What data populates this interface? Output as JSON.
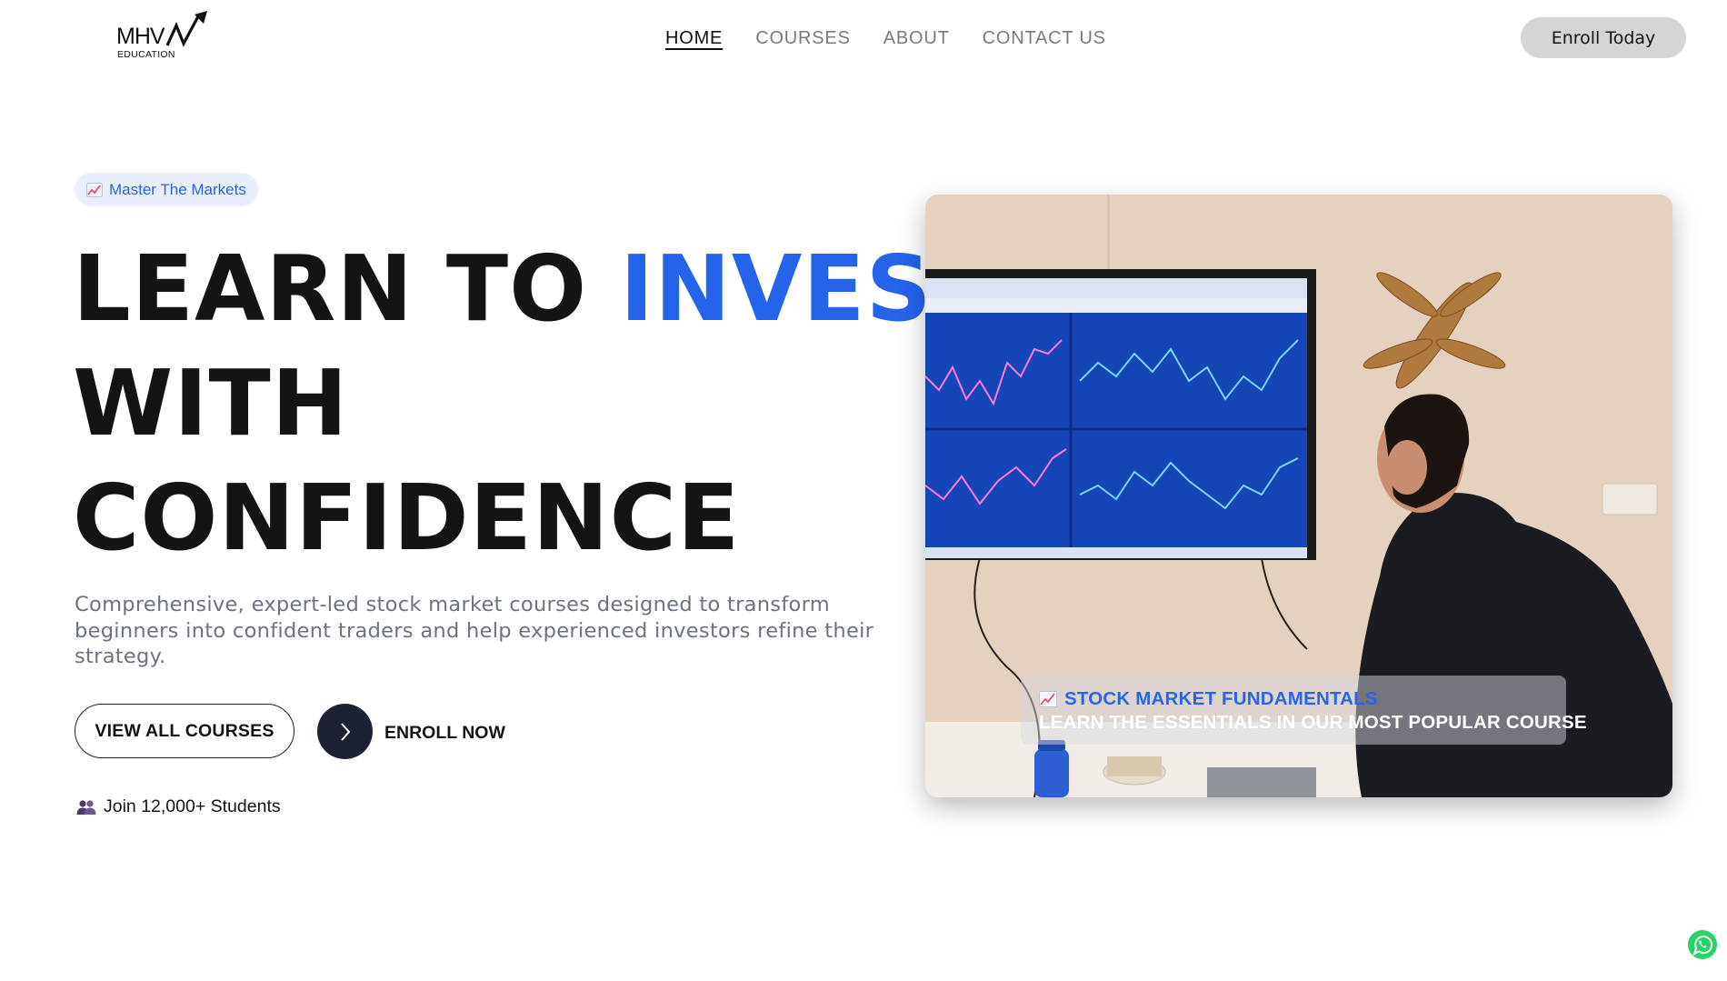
{
  "header": {
    "logo_text": "MHV",
    "logo_sub": "EDUCATION",
    "nav": [
      {
        "label": "HOME",
        "active": true
      },
      {
        "label": "COURSES",
        "active": false
      },
      {
        "label": "ABOUT",
        "active": false
      },
      {
        "label": "CONTACT US",
        "active": false
      }
    ],
    "cta_label": "Enroll Today"
  },
  "hero": {
    "badge": {
      "icon": "chart-increasing-icon",
      "label": "Master The Markets"
    },
    "headline": {
      "line1_part1": "LEARN TO ",
      "line1_highlight": "INVEST",
      "line2": "WITH",
      "line3": "CONFIDENCE"
    },
    "description": "Comprehensive, expert-led stock market courses designed to transform beginners into confident traders and help experienced investors refine their strategy.",
    "buttons": {
      "view_all": "VIEW ALL COURSES",
      "enroll_now": "ENROLL NOW"
    },
    "students": {
      "icon": "users-icon",
      "label": "Join 12,000+ Students"
    },
    "image_caption": {
      "icon": "chart-increasing-icon",
      "title": "STOCK MARKET FUNDAMENTALS",
      "subtitle": "LEARN THE ESSENTIALS IN OUR MOST POPULAR COURSE"
    }
  },
  "floating": {
    "icon": "whatsapp-icon"
  },
  "colors": {
    "accent_blue": "#2563eb",
    "dark_button": "#1d2233",
    "badge_bg": "#e9effd",
    "muted_text": "#6b7380"
  }
}
